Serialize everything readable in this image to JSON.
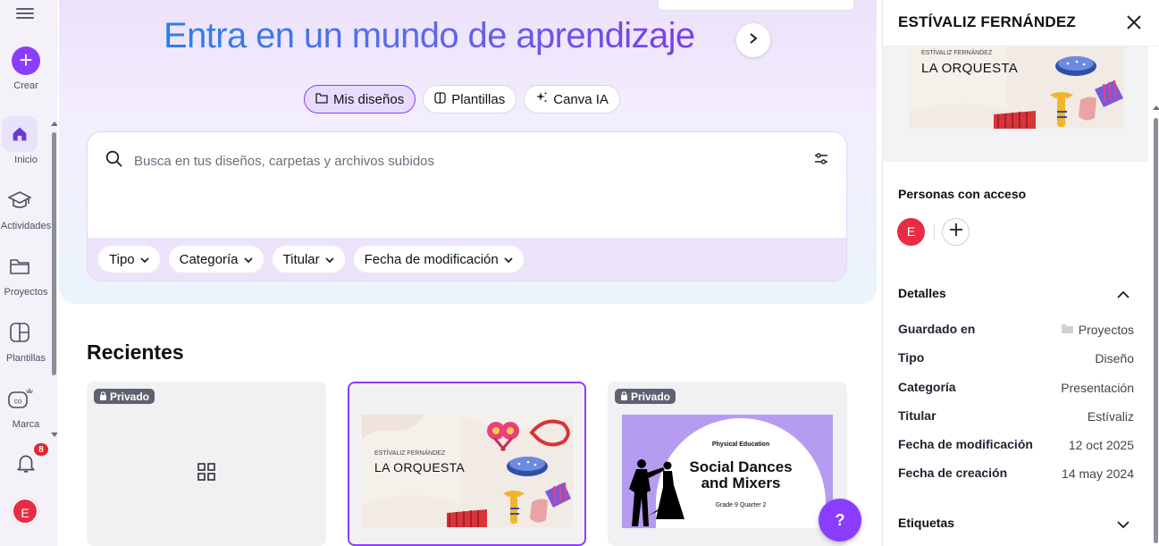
{
  "rail": {
    "create_label": "Crear",
    "items": [
      {
        "label": "Inicio",
        "icon": "home-icon"
      },
      {
        "label": "Actividades",
        "icon": "graduation-cap-icon"
      },
      {
        "label": "Proyectos",
        "icon": "folder-icon"
      },
      {
        "label": "Plantillas",
        "icon": "templates-icon"
      },
      {
        "label": "Marca",
        "icon": "brand-icon"
      }
    ],
    "notifications_count": "8",
    "avatar_initial": "E"
  },
  "hero": {
    "title": "Entra en un mundo de aprendizaje",
    "tabs": [
      {
        "label": "Mis diseños",
        "active": true
      },
      {
        "label": "Plantillas",
        "active": false
      },
      {
        "label": "Canva IA",
        "active": false
      }
    ]
  },
  "search": {
    "placeholder": "Busca en tus diseños, carpetas y archivos subidos",
    "filters": [
      "Tipo",
      "Categoría",
      "Titular",
      "Fecha de modificación"
    ]
  },
  "recents": {
    "title": "Recientes",
    "cards": [
      {
        "badge": "Privado"
      },
      {
        "author": "ESTÍVALIZ FERNÁNDEZ",
        "title": "LA ORQUESTA"
      },
      {
        "badge": "Privado",
        "kicker": "Physical Education",
        "title_line1": "Social Dances",
        "title_line2": "and Mixers",
        "subtitle": "Grade 9 Quarter 2"
      }
    ]
  },
  "help_label": "?",
  "panel": {
    "title": "ESTÍVALIZ FERNÁNDEZ",
    "preview_author": "ESTÍVALIZ FERNÁNDEZ",
    "preview_title": "LA ORQUESTA",
    "access_label": "Personas con acceso",
    "access_initial": "E",
    "details_label": "Detalles",
    "details": [
      {
        "label": "Guardado en",
        "value": "Proyectos"
      },
      {
        "label": "Tipo",
        "value": "Diseño"
      },
      {
        "label": "Categoría",
        "value": "Presentación"
      },
      {
        "label": "Titular",
        "value": "Estívaliz"
      },
      {
        "label": "Fecha de modificación",
        "value": "12 oct 2025"
      },
      {
        "label": "Fecha de creación",
        "value": "14 may 2024"
      }
    ],
    "tags_label": "Etiquetas"
  },
  "colors": {
    "accent": "#8b3dff",
    "avatar": "#e62d45",
    "badge": "#e5262e"
  }
}
